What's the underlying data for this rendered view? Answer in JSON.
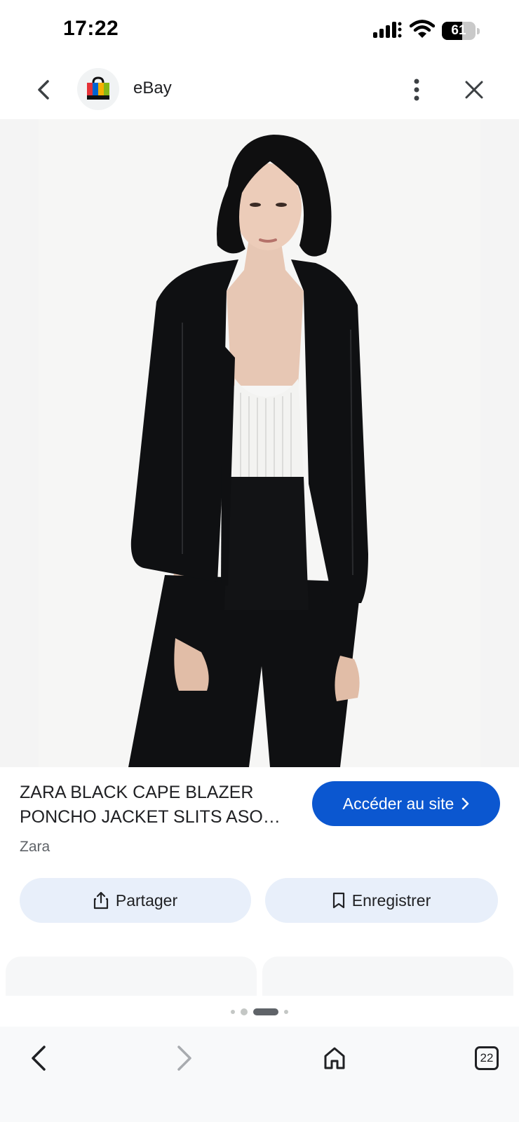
{
  "status_bar": {
    "time": "17:22",
    "battery_level": "61",
    "battery_fraction": 0.61
  },
  "header": {
    "site_name": "eBay",
    "icons": {
      "back": "chevron-left-icon",
      "logo": "shopping-bag-icon",
      "more": "more-vert-icon",
      "close": "close-icon"
    }
  },
  "product": {
    "title_line1": "ZARA BLACK CAPE BLAZER",
    "title_line2": "PONCHO JACKET SLITS ASO…",
    "source": "Zara",
    "visit_label": "Accéder au site"
  },
  "actions": {
    "share_label": "Partager",
    "save_label": "Enregistrer"
  },
  "carousel": {
    "active_index": 2,
    "count": 4
  },
  "bottom_nav": {
    "tab_count": "22",
    "icons": [
      "arrow-back-icon",
      "arrow-forward-icon",
      "home-icon",
      "tabs-icon"
    ]
  },
  "colors": {
    "primary_button": "#0b57d0",
    "tonal_button": "#e8effa",
    "text_primary": "#202124",
    "text_secondary": "#5f6368",
    "jacket": "#0f1012"
  }
}
